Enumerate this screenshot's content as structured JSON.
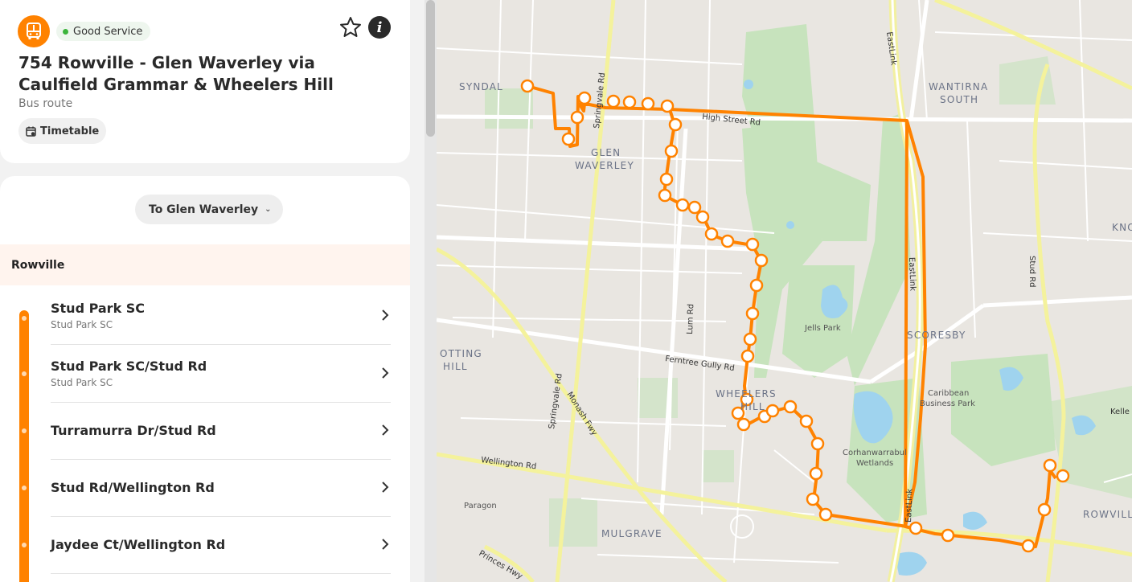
{
  "header": {
    "mode_icon": "bus-icon",
    "status": "Good Service",
    "status_color": "#3cb43c",
    "favourite_icon": "star-icon",
    "info_icon": "info-icon",
    "info_glyph": "i",
    "title": "754 Rowville - Glen Waverley via Caulfield Grammar & Wheelers Hill",
    "subtitle": "Bus route",
    "timetable_label": "Timetable",
    "timetable_icon": "calendar-icon",
    "accent_color": "#ff8200"
  },
  "direction": {
    "label": "To Glen Waverley",
    "icon": "chevron-down-icon"
  },
  "origin": "Rowville",
  "stops": [
    {
      "name": "Stud Park SC",
      "area": "Stud Park SC"
    },
    {
      "name": "Stud Park SC/Stud Rd",
      "area": "Stud Park SC"
    },
    {
      "name": "Turramurra Dr/Stud Rd",
      "area": ""
    },
    {
      "name": "Stud Rd/Wellington Rd",
      "area": ""
    },
    {
      "name": "Jaydee Ct/Wellington Rd",
      "area": ""
    }
  ],
  "map": {
    "suburbs": [
      "SYNDAL",
      "GLEN",
      "WAVERLEY",
      "WANTIRNA",
      "SOUTH",
      "SCORESBY",
      "WHEELERS",
      "HILL",
      "MULGRAVE",
      "ROWVILLE",
      "OTTING",
      "HILL",
      "KNO"
    ],
    "roads": [
      "High Street Rd",
      "Springvale Rd",
      "Lum Rd",
      "Ferntree Gully Rd",
      "Springvale Rd",
      "Monash Fwy",
      "Wellington Rd",
      "Princes Hwy",
      "EastLink",
      "Stud Rd",
      "Kelle",
      "EastLink",
      "EastLink"
    ],
    "places": [
      "Jells Park",
      "Caribbean",
      "Business Park",
      "Corhanwarrabul",
      "Wetlands",
      "Paragon"
    ],
    "route_color": "#ff8200"
  }
}
